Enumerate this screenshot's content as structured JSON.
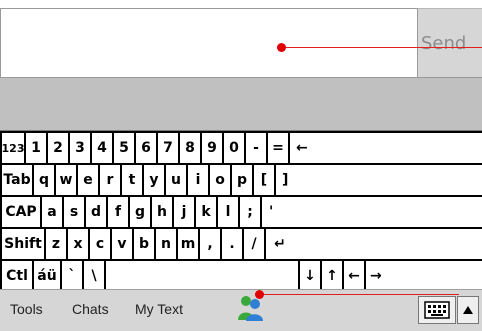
{
  "compose": {
    "send_label": "Send"
  },
  "keyboard": {
    "rows": [
      [
        "123",
        "1",
        "2",
        "3",
        "4",
        "5",
        "6",
        "7",
        "8",
        "9",
        "0",
        "-",
        "=",
        "←"
      ],
      [
        "Tab",
        "q",
        "w",
        "e",
        "r",
        "t",
        "y",
        "u",
        "i",
        "o",
        "p",
        "[",
        "]"
      ],
      [
        "CAP",
        "a",
        "s",
        "d",
        "f",
        "g",
        "h",
        "j",
        "k",
        "l",
        ";",
        "'"
      ],
      [
        "Shift",
        "z",
        "x",
        "c",
        "v",
        "b",
        "n",
        "m",
        ",",
        ".",
        "/",
        "↵"
      ],
      [
        "Ctl",
        "áü",
        "`",
        "\\",
        "",
        "↓",
        "↑",
        "←",
        "→"
      ]
    ]
  },
  "toolbar": {
    "menus": [
      "Tools",
      "Chats",
      "My Text"
    ],
    "icons": [
      "messenger-buddy-icon",
      "keyboard-icon",
      "up-arrow-icon"
    ]
  },
  "colors": {
    "annotation": "#e00000",
    "band": "#c0c0c0",
    "toolbar": "#d6d6d6"
  }
}
